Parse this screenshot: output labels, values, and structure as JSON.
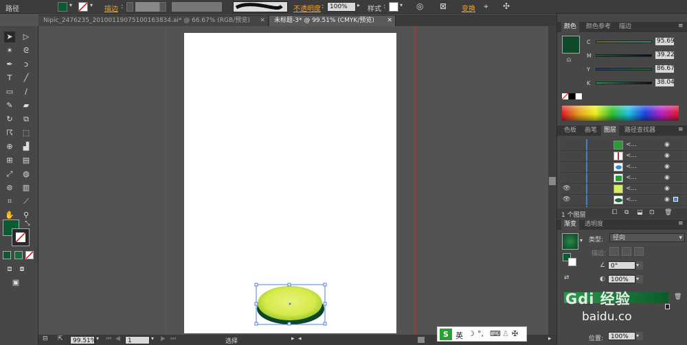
{
  "control_bar": {
    "label": "路径",
    "stroke_label": "描边",
    "opacity_label": "不透明度",
    "opacity_value": "100%",
    "style_label": "样式",
    "transform_label": "变换",
    "fill_color": "#0d5a30"
  },
  "doc_tabs": [
    {
      "label": "Nipic_2476235_20100119075100163834.ai* @ 66.67% (RGB/预览)"
    },
    {
      "label": "未标题-3* @ 99.51% (CMYK/预览)"
    }
  ],
  "color_panel": {
    "tabs": [
      "颜色",
      "颜色参考",
      "描边"
    ],
    "fill_color": "#0f4a2a",
    "channels": [
      {
        "label": "C",
        "value": "95.69"
      },
      {
        "label": "M",
        "value": "39.22"
      },
      {
        "label": "Y",
        "value": "86.67"
      },
      {
        "label": "K",
        "value": "38.04"
      }
    ]
  },
  "layers_panel": {
    "tabs": [
      "色板",
      "画笔",
      "图层",
      "路径查找器"
    ],
    "rows": [
      {
        "name": "<..."
      },
      {
        "name": "<..."
      },
      {
        "name": "<..."
      },
      {
        "name": "<..."
      },
      {
        "name": "<..."
      },
      {
        "name": "<..."
      }
    ],
    "footer": "1 个图层"
  },
  "gradient_panel": {
    "tabs": [
      "渐变",
      "透明度"
    ],
    "type_label": "类型:",
    "type_value": "径向",
    "stroke_label": "描边:",
    "angle_value": "0°",
    "ratio_value": "100%",
    "position_label": "位置:",
    "position_value": "100%"
  },
  "status_bar": {
    "zoom": "99.51%",
    "page": "1",
    "mode": "选择"
  },
  "ime_bar": {
    "lang": "英"
  },
  "watermark": {
    "text1": "Gdi 经验",
    "text2": "baidu.co"
  }
}
